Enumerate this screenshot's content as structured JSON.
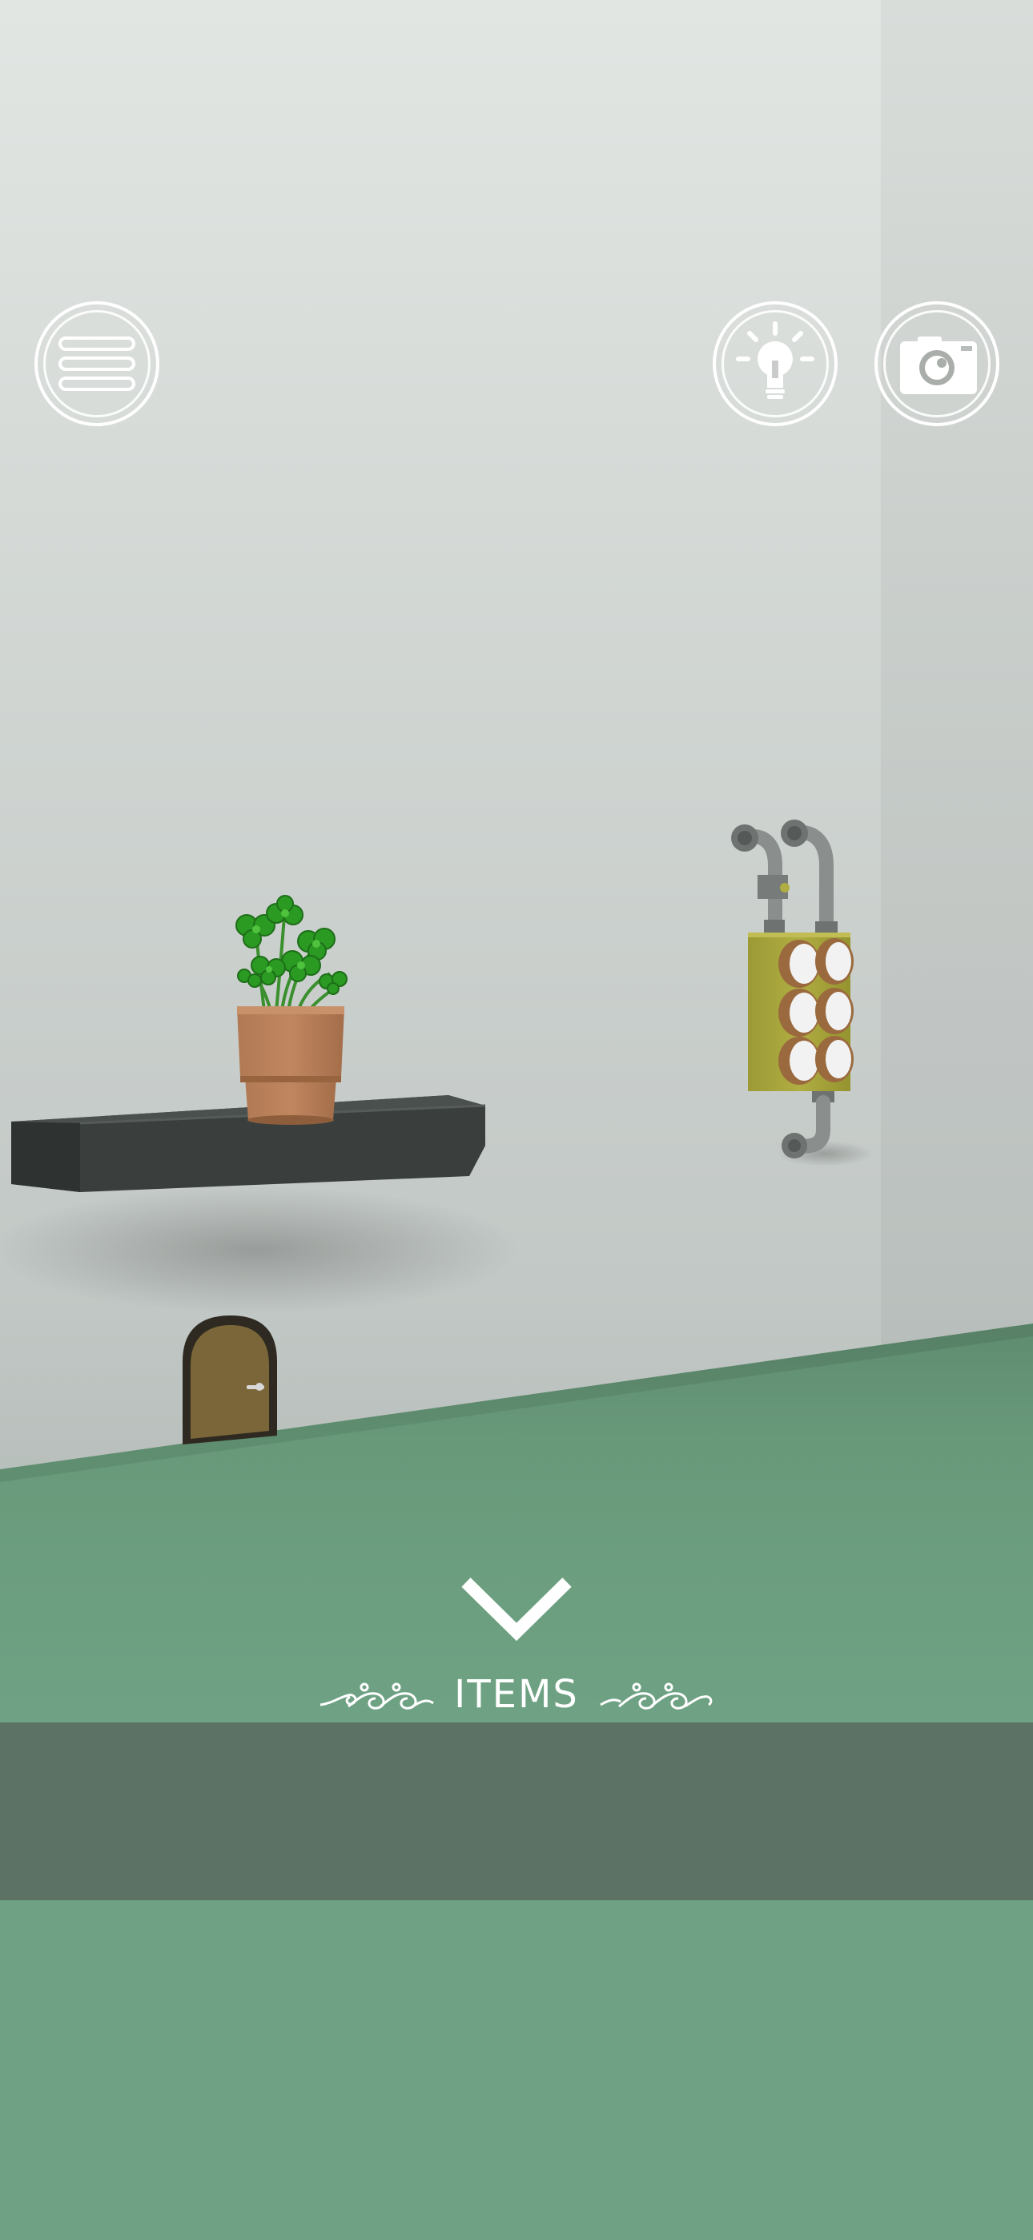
{
  "hud": {
    "menu_icon": "hamburger-menu-icon",
    "hint_icon": "lightbulb-icon",
    "camera_icon": "camera-icon",
    "button_color": "#ffffff"
  },
  "scene": {
    "wall_color": "#cfd5d2",
    "floor_color": "#6a9a7a",
    "shelf_color": "#3a3f3e",
    "pot_color": "#b07a55",
    "plant_color": "#2e8b2e",
    "switch_box_color": "#a7a33a",
    "pipe_color": "#8a8e8c",
    "door_color": "#7a6638"
  },
  "navigation": {
    "down_icon": "chevron-down-icon"
  },
  "items": {
    "title": "ITEMS",
    "bar_color": "#5c7264"
  }
}
